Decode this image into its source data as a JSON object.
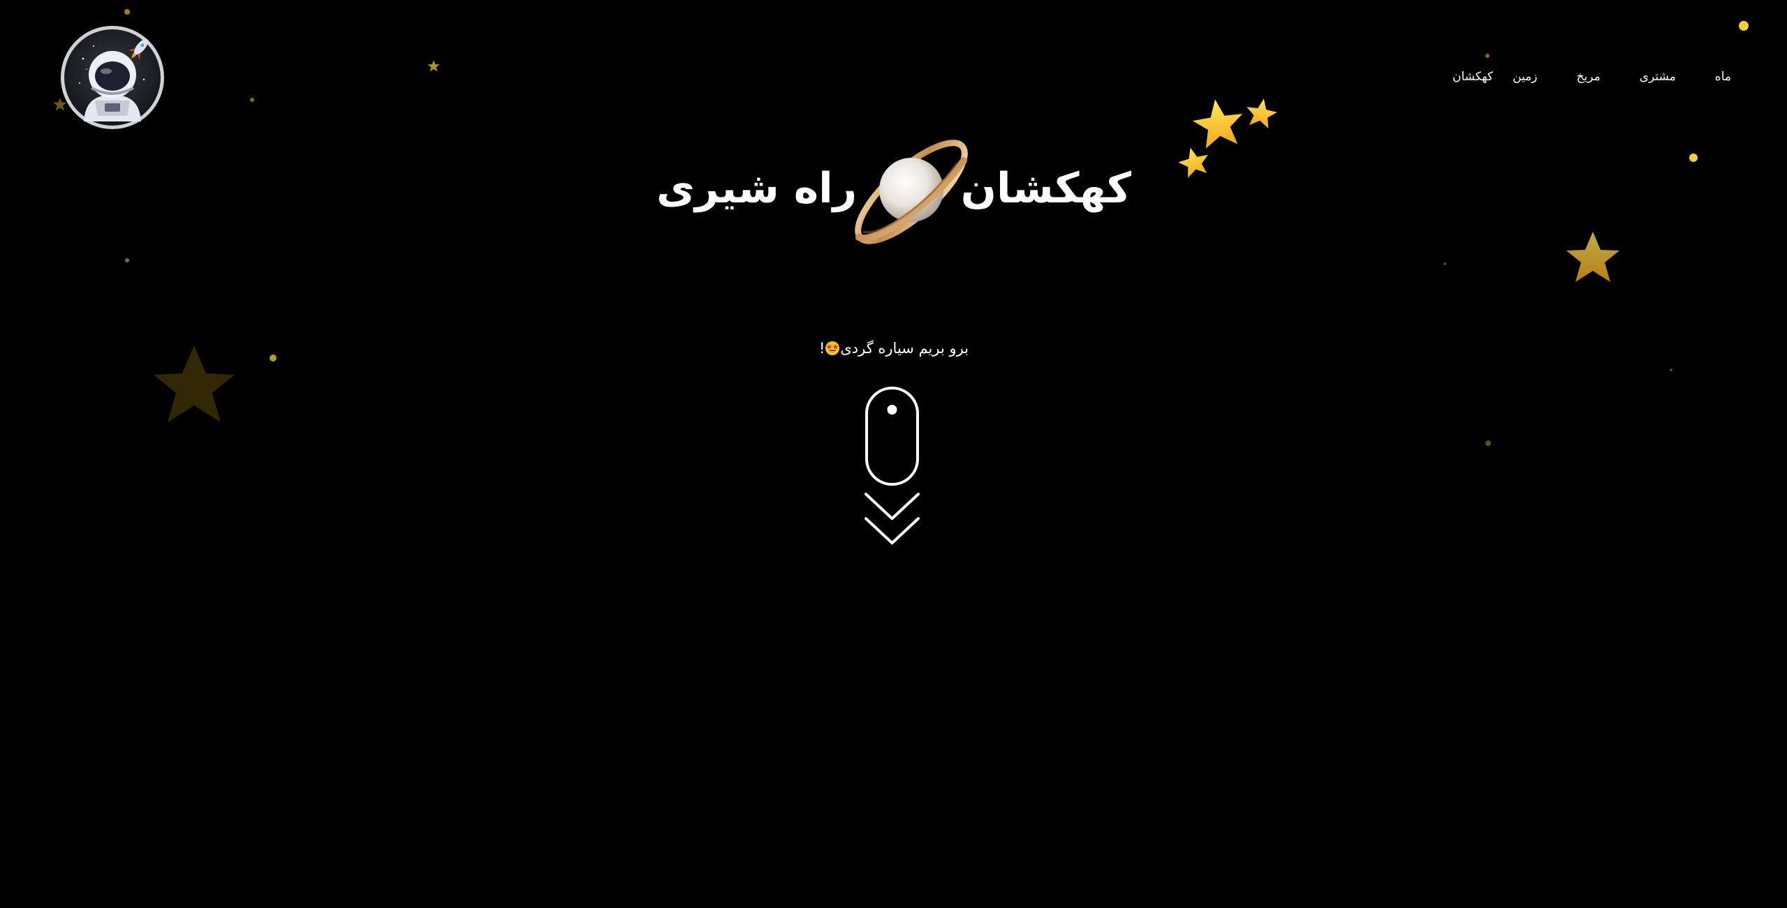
{
  "nav": {
    "items": [
      {
        "label": "کهکشان"
      },
      {
        "label": "زمین"
      },
      {
        "label": "مریخ"
      },
      {
        "label": "مشتری"
      },
      {
        "label": "ماه"
      }
    ]
  },
  "hero": {
    "title_right": "کهکشان",
    "title_left": "راه شیری",
    "subtitle": "برو بریم سیاره گردی",
    "subtitle_suffix": "!"
  },
  "icons": {
    "logo": "astronaut-logo-icon",
    "planet": "saturn-planet-icon",
    "emoji": "star-struck-emoji-icon",
    "scroll": "mouse-scroll-icon",
    "chevrons": "double-chevron-down-icon",
    "stars": "star-icon"
  },
  "colors": {
    "background": "#000000",
    "text": "#ffffff",
    "star": "#f7c52b",
    "planet_ring": "#d9a86a"
  }
}
